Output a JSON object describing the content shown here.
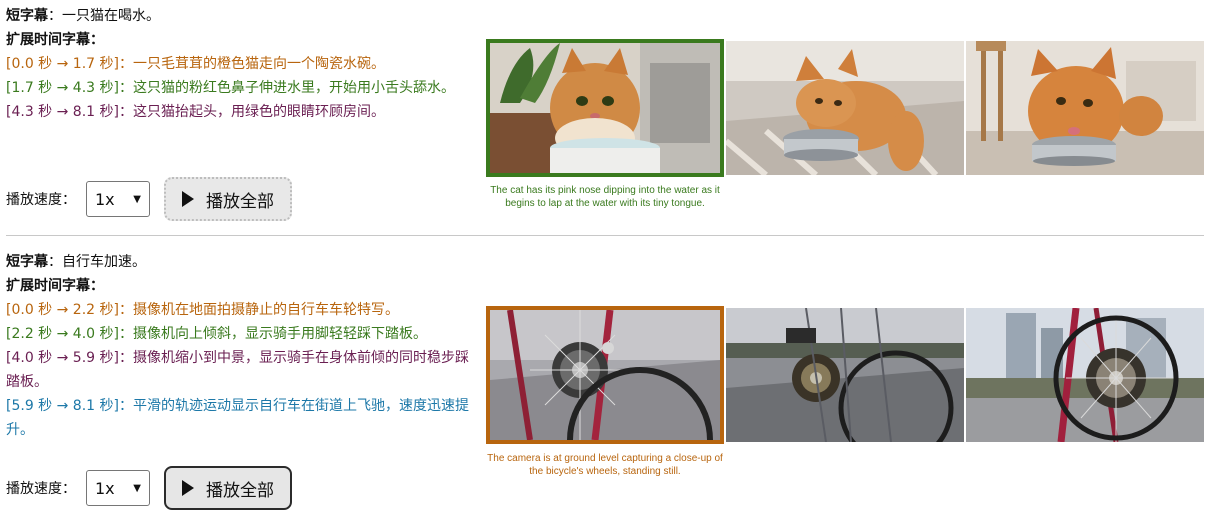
{
  "colors": {
    "seg_orange": "#b8650e",
    "seg_green": "#3a7a1e",
    "seg_purple": "#6a1f52",
    "seg_blue": "#1d78a8",
    "caption_green": "#3a7a1e",
    "caption_orange": "#b8650e"
  },
  "examples": [
    {
      "short_label": "短字幕",
      "short_text": "：一只猫在喝水。",
      "extended_label": "扩展时间字幕：",
      "segments": [
        {
          "ts": "[0.0 秒 → 1.7 秒]",
          "text": "：一只毛茸茸的橙色猫走向一个陶瓷水碗。",
          "color": "#b8650e"
        },
        {
          "ts": "[1.7 秒 → 4.3 秒]",
          "text": "：这只猫的粉红色鼻子伸进水里，开始用小舌头舔水。",
          "color": "#3a7a1e"
        },
        {
          "ts": "[4.3 秒 → 8.1 秒]",
          "text": "：这只猫抬起头，用绿色的眼睛环顾房间。",
          "color": "#6a1f52"
        }
      ],
      "speed_label": "播放速度：",
      "speed_value": "1x",
      "play_all_label": "播放全部",
      "frame_caption": "The cat has its pink nose dipping into the water as it begins to lap at the water with its tiny tongue.",
      "frame_icons": [
        "cat-drinking-bowl-frame",
        "cat-metal-bowl-frame",
        "cat-bowl-room-frame"
      ]
    },
    {
      "short_label": "短字幕",
      "short_text": "：自行车加速。",
      "extended_label": "扩展时间字幕：",
      "segments": [
        {
          "ts": "[0.0 秒 → 2.2 秒]",
          "text": "：摄像机在地面拍摄静止的自行车车轮特写。",
          "color": "#b8650e"
        },
        {
          "ts": "[2.2 秒 → 4.0 秒]",
          "text": "：摄像机向上倾斜，显示骑手用脚轻轻踩下踏板。",
          "color": "#3a7a1e"
        },
        {
          "ts": "[4.0 秒 → 5.9 秒]",
          "text": "：摄像机缩小到中景，显示骑手在身体前倾的同时稳步踩踏板。",
          "color": "#6a1f52"
        },
        {
          "ts": "[5.9 秒 → 8.1 秒]",
          "text": "：平滑的轨迹运动显示自行车在街道上飞驰，速度迅速提升。",
          "color": "#1d78a8"
        }
      ],
      "speed_label": "播放速度：",
      "speed_value": "1x",
      "play_all_label": "播放全部",
      "frame_caption": "The camera is at ground level capturing a close-up of the bicycle's wheels, standing still.",
      "frame_icons": [
        "bike-wheel-closeup-frame",
        "bike-gears-street-frame",
        "bike-wheel-city-frame"
      ]
    }
  ]
}
